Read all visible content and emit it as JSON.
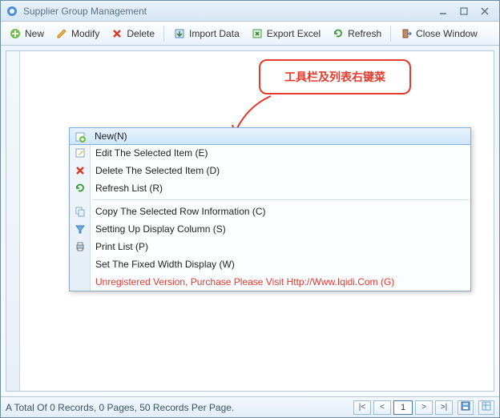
{
  "window": {
    "title": "Supplier Group Management"
  },
  "toolbar": {
    "new": "New",
    "modify": "Modify",
    "delete": "Delete",
    "import": "Import Data",
    "export": "Export Excel",
    "refresh": "Refresh",
    "close": "Close Window"
  },
  "callout": {
    "text": "工具栏及列表右键菜"
  },
  "context_menu": {
    "items": [
      {
        "label": "New(N)",
        "icon": "add-icon",
        "selected": true
      },
      {
        "label": "Edit The Selected Item (E)",
        "icon": "edit-icon"
      },
      {
        "label": "Delete The Selected Item (D)",
        "icon": "delete-icon"
      },
      {
        "label": "Refresh List  (R)",
        "icon": "refresh-icon"
      },
      {
        "sep": true
      },
      {
        "label": "Copy The Selected Row Information (C)",
        "icon": "copy-icon"
      },
      {
        "label": "Setting Up Display Column (S)",
        "icon": "filter-icon"
      },
      {
        "label": "Print List (P)",
        "icon": "print-icon"
      },
      {
        "label": "Set The Fixed Width Display (W)",
        "icon": ""
      },
      {
        "label": "Unregistered Version, Purchase Please Visit Http://Www.Iqidi.Com  (G)",
        "icon": "",
        "red": true
      }
    ]
  },
  "status": {
    "text": "A Total Of 0 Records, 0 Pages, 50 Records Per Page.",
    "page": "1",
    "first": "|<",
    "prev": "<",
    "next": ">",
    "last": ">|"
  }
}
